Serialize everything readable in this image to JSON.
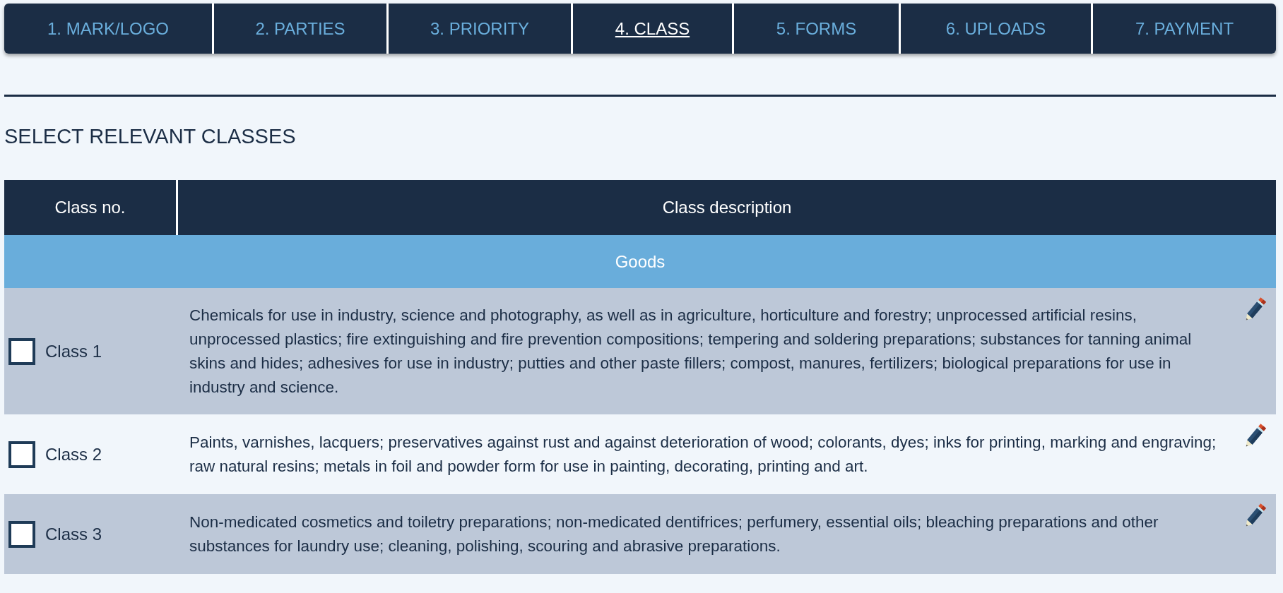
{
  "tabs": [
    {
      "label": "1. MARK/LOGO",
      "selected": false
    },
    {
      "label": "2. PARTIES",
      "selected": false
    },
    {
      "label": "3. PRIORITY",
      "selected": false
    },
    {
      "label": "4. CLASS",
      "selected": true
    },
    {
      "label": "5. FORMS",
      "selected": false
    },
    {
      "label": "6. UPLOADS",
      "selected": false
    },
    {
      "label": "7. PAYMENT",
      "selected": false
    }
  ],
  "heading": "SELECT RELEVANT CLASSES",
  "table": {
    "columns": [
      "Class no.",
      "Class description"
    ],
    "group": "Goods",
    "rows": [
      {
        "class": "Class 1",
        "checked": false,
        "description": "Chemicals for use in industry, science and photography, as well as in agriculture, horticulture and forestry; unprocessed artificial resins, unprocessed plastics; fire extinguishing and fire prevention compositions; tempering and soldering preparations; substances for tanning animal skins and hides; adhesives for use in industry; putties and other paste fillers; compost, manures, fertilizers; biological preparations for use in industry and science."
      },
      {
        "class": "Class 2",
        "checked": false,
        "description": "Paints, varnishes, lacquers; preservatives against rust and against deterioration of wood; colorants, dyes; inks for printing, marking and engraving; raw natural resins; metals in foil and powder form for use in painting, decorating, printing and art."
      },
      {
        "class": "Class 3",
        "checked": false,
        "description": "Non-medicated cosmetics and toiletry preparations; non-medicated dentifrices; perfumery, essential oils; bleaching preparations and other substances for laundry use; cleaning, polishing, scouring and abrasive preparations."
      }
    ]
  }
}
